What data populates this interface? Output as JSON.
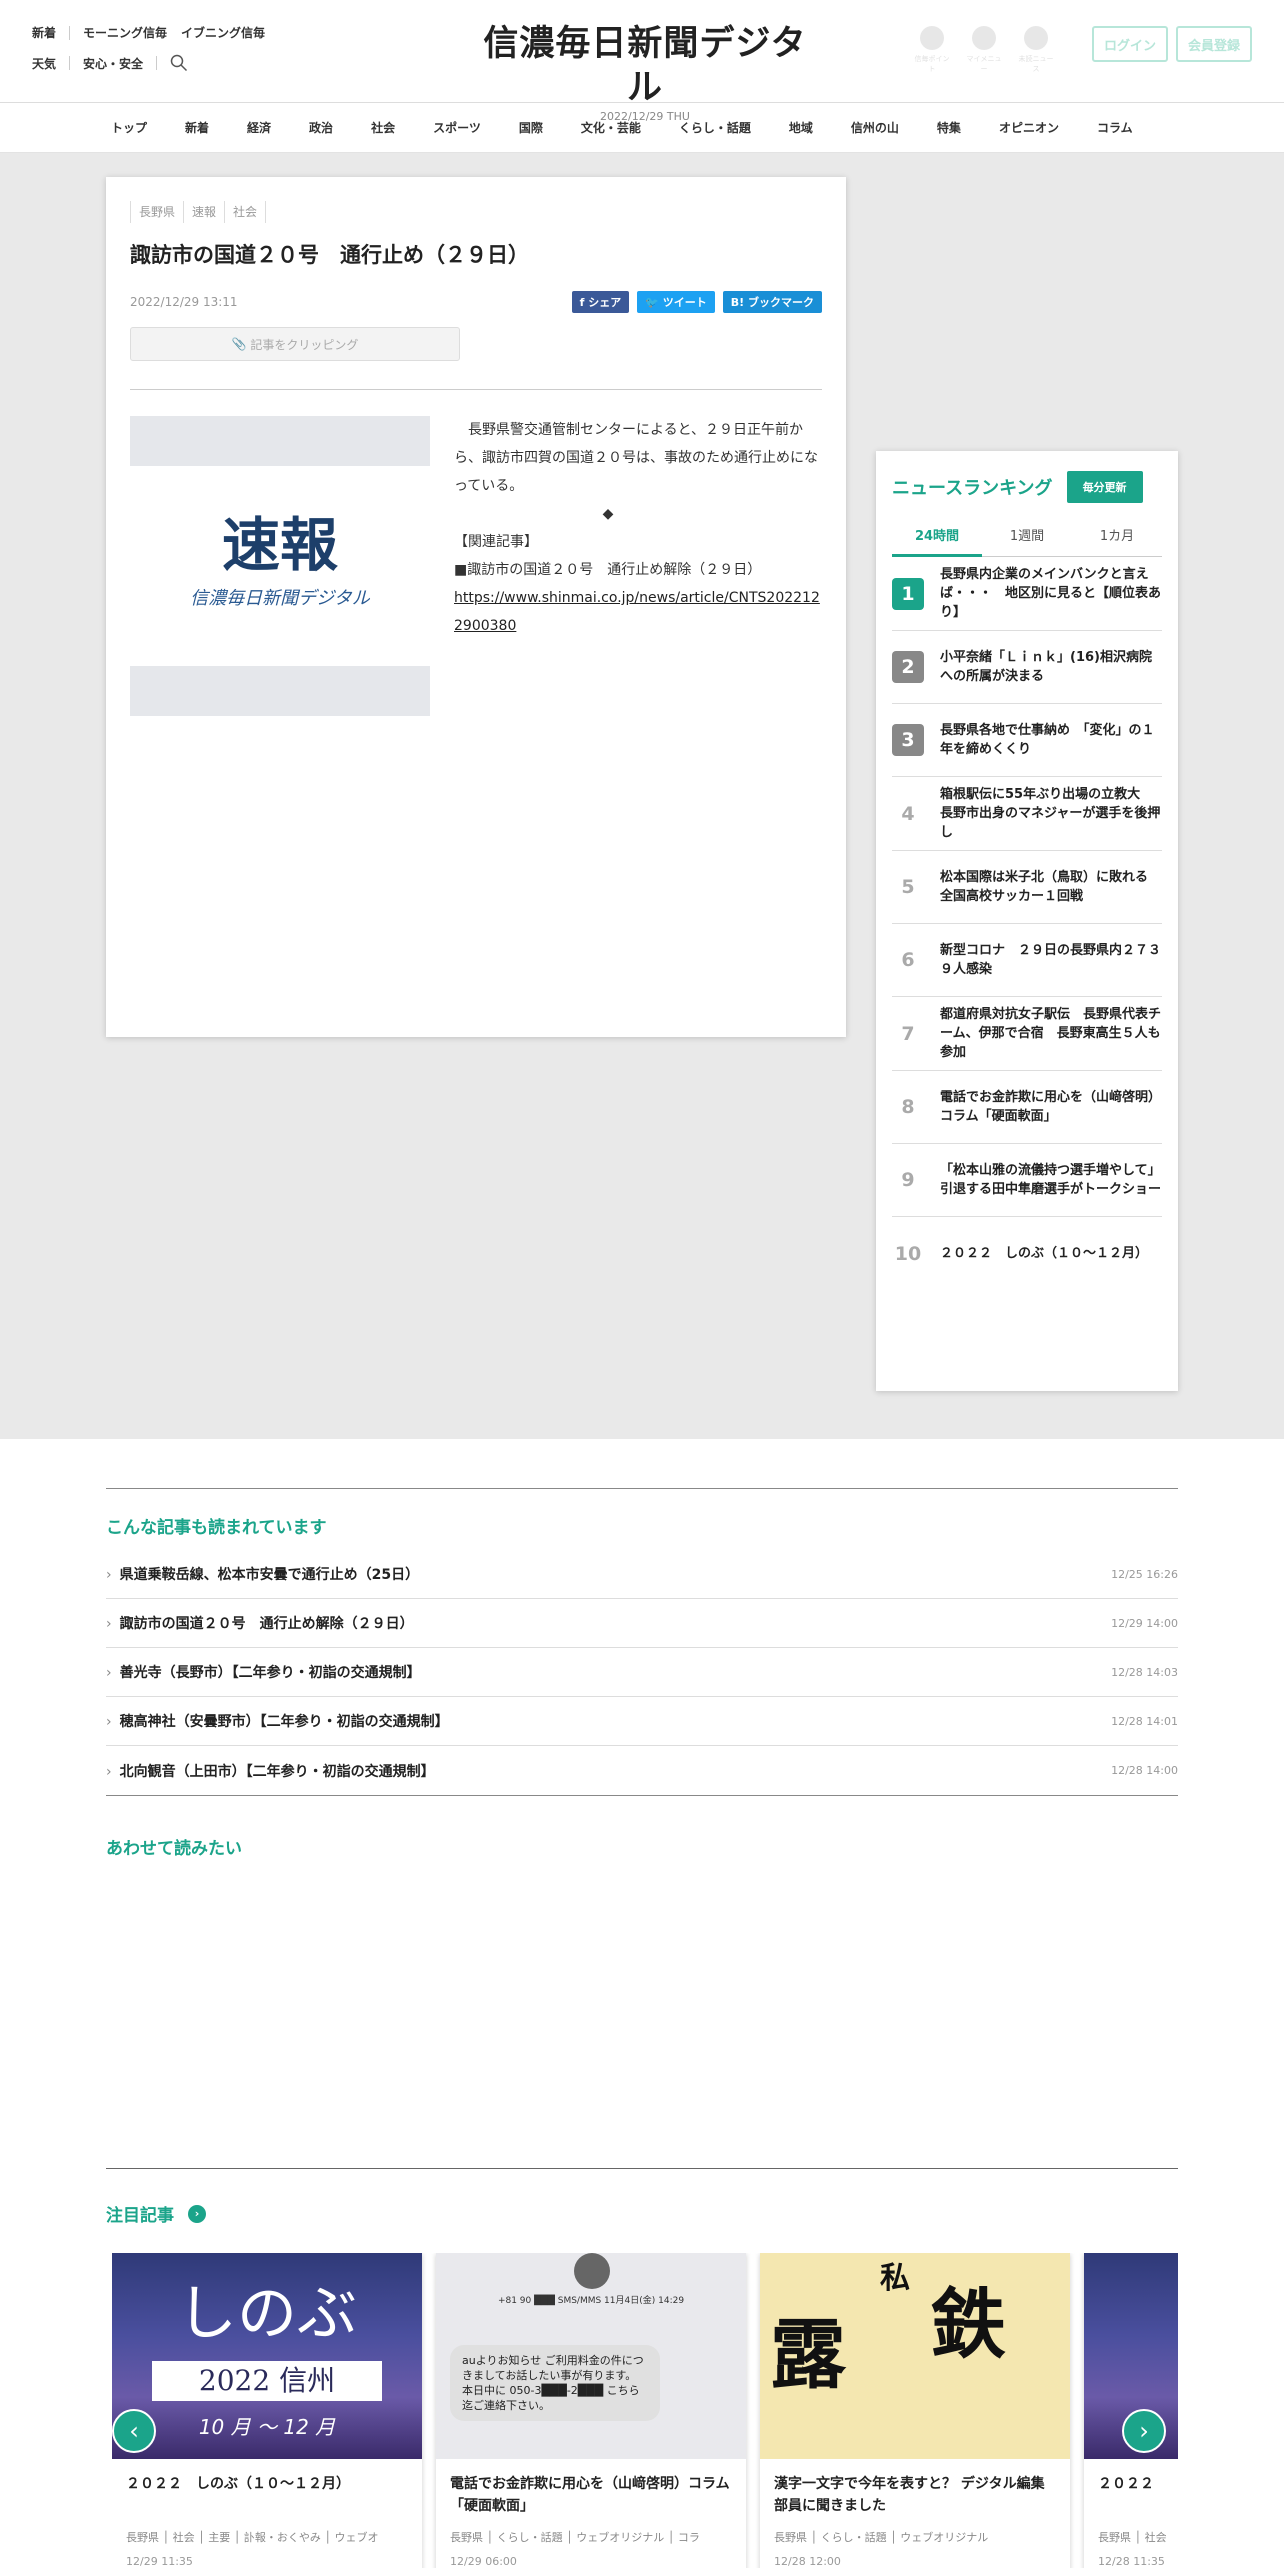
{
  "header": {
    "links_row1": [
      "新着",
      "モーニング信毎",
      "イブニング信毎"
    ],
    "links_row2": [
      "天気",
      "安心・安全"
    ],
    "logo": "信濃毎日新聞デジタル",
    "date": "2022/12/29 THU",
    "icons": [
      "信毎ポイント",
      "マイメニュー",
      "未読ニュース"
    ],
    "login": "ログイン",
    "register": "会員登録"
  },
  "nav": [
    "トップ",
    "新着",
    "経済",
    "政治",
    "社会",
    "スポーツ",
    "国際",
    "文化・芸能",
    "くらし・話題",
    "地域",
    "信州の山",
    "特集",
    "オピニオン",
    "コラム"
  ],
  "article": {
    "tags": [
      "長野県",
      "速報",
      "社会"
    ],
    "title": "諏訪市の国道２０号　通行止め（２９日）",
    "date": "2022/12/29 13:11",
    "share_fb": "f シェア",
    "share_tw": "ツイート",
    "share_hb": "B! ブックマーク",
    "clip": "記事をクリッピング",
    "thumb_big": "速報",
    "thumb_sub": "信濃毎日新聞デジタル",
    "body": "　長野県警交通管制センターによると、２９日正午前から、諏訪市四賀の国道２０号は、事故のため通行止めになっている。",
    "diamond": "◆",
    "related": "【関連記事】",
    "related_item": "■諏訪市の国道２０号　通行止め解除（２９日）",
    "link": "https://www.shinmai.co.jp/news/article/CNTS2022122900380"
  },
  "ranking": {
    "title": "ニュースランキング",
    "badge": "毎分更新",
    "tabs": [
      "24時間",
      "1週間",
      "1カ月"
    ],
    "items": [
      "長野県内企業のメインバンクと言えば・・・　地区別に見ると【順位表あり】",
      "小平奈緒「Ｌｉｎｋ」(16)相沢病院への所属が決まる",
      "長野県各地で仕事納め　「変化」の１年を締めくくり",
      "箱根駅伝に55年ぶり出場の立教大　長野市出身のマネジャーが選手を後押し",
      "松本国際は米子北（鳥取）に敗れる　全国高校サッカー１回戦",
      "新型コロナ　２９日の長野県内２７３９人感染",
      "都道府県対抗女子駅伝　長野県代表チーム、伊那で合宿　長野東高生５人も参加",
      "電話でお金詐欺に用心を（山﨑啓明）コラム「硬面軟面」",
      "「松本山雅の流儀持つ選手増やして」　引退する田中隼磨選手がトークショー",
      "２０２２　しのぶ（１０～１２月）"
    ]
  },
  "also": {
    "title": "こんな記事も読まれています",
    "items": [
      {
        "t": "県道乗鞍岳線、松本市安曇で通行止め（25日）",
        "d": "12/25 16:26"
      },
      {
        "t": "諏訪市の国道２０号　通行止め解除（２９日）",
        "d": "12/29 14:00"
      },
      {
        "t": "善光寺（長野市）【二年参り・初詣の交通規制】",
        "d": "12/28 14:03"
      },
      {
        "t": "穂高神社（安曇野市）【二年参り・初詣の交通規制】",
        "d": "12/28 14:01"
      },
      {
        "t": "北向観音（上田市）【二年参り・初詣の交通規制】",
        "d": "12/28 14:00"
      }
    ]
  },
  "recommend": {
    "title": "あわせて読みたい"
  },
  "featured": {
    "title": "注目記事",
    "cards": [
      {
        "t": "２０２２　しのぶ（１０～１２月）",
        "tags": "長野県 │ 社会 │ 主要 │ 訃報・おくやみ │ ウェブオ",
        "d": "12/29 11:35",
        "img_big": "しのぶ",
        "img_box": "2022 信州",
        "img_mo": "10 月 ～ 12 月"
      },
      {
        "t": "電話でお金詐欺に用心を（山﨑啓明）コラム「硬面軟面」",
        "tags": "長野県 │ くらし・話題 │ ウェブオリジナル │ コラ",
        "d": "12/29 06:00",
        "img_top": "+81 90 ███ SMS/MMS 11月4日(金) 14:29",
        "img_bubble": "auよりお知らせ ご利用料金の件につきましてお話したい事が有ります。 本日中に 050-3███-2███ こちら迄ご連絡下さい。"
      },
      {
        "t": "漢字一文字で今年を表すと？ デジタル編集部員に聞きました",
        "tags": "長野県 │ くらし・話題 │ ウェブオリジナル",
        "d": "12/28 12:00",
        "img_k1": "露",
        "img_k2": "鉄",
        "img_k3": "私"
      },
      {
        "t": "２０２２",
        "tags": "長野県 │ 社会",
        "d": "12/28 11:35"
      }
    ]
  }
}
